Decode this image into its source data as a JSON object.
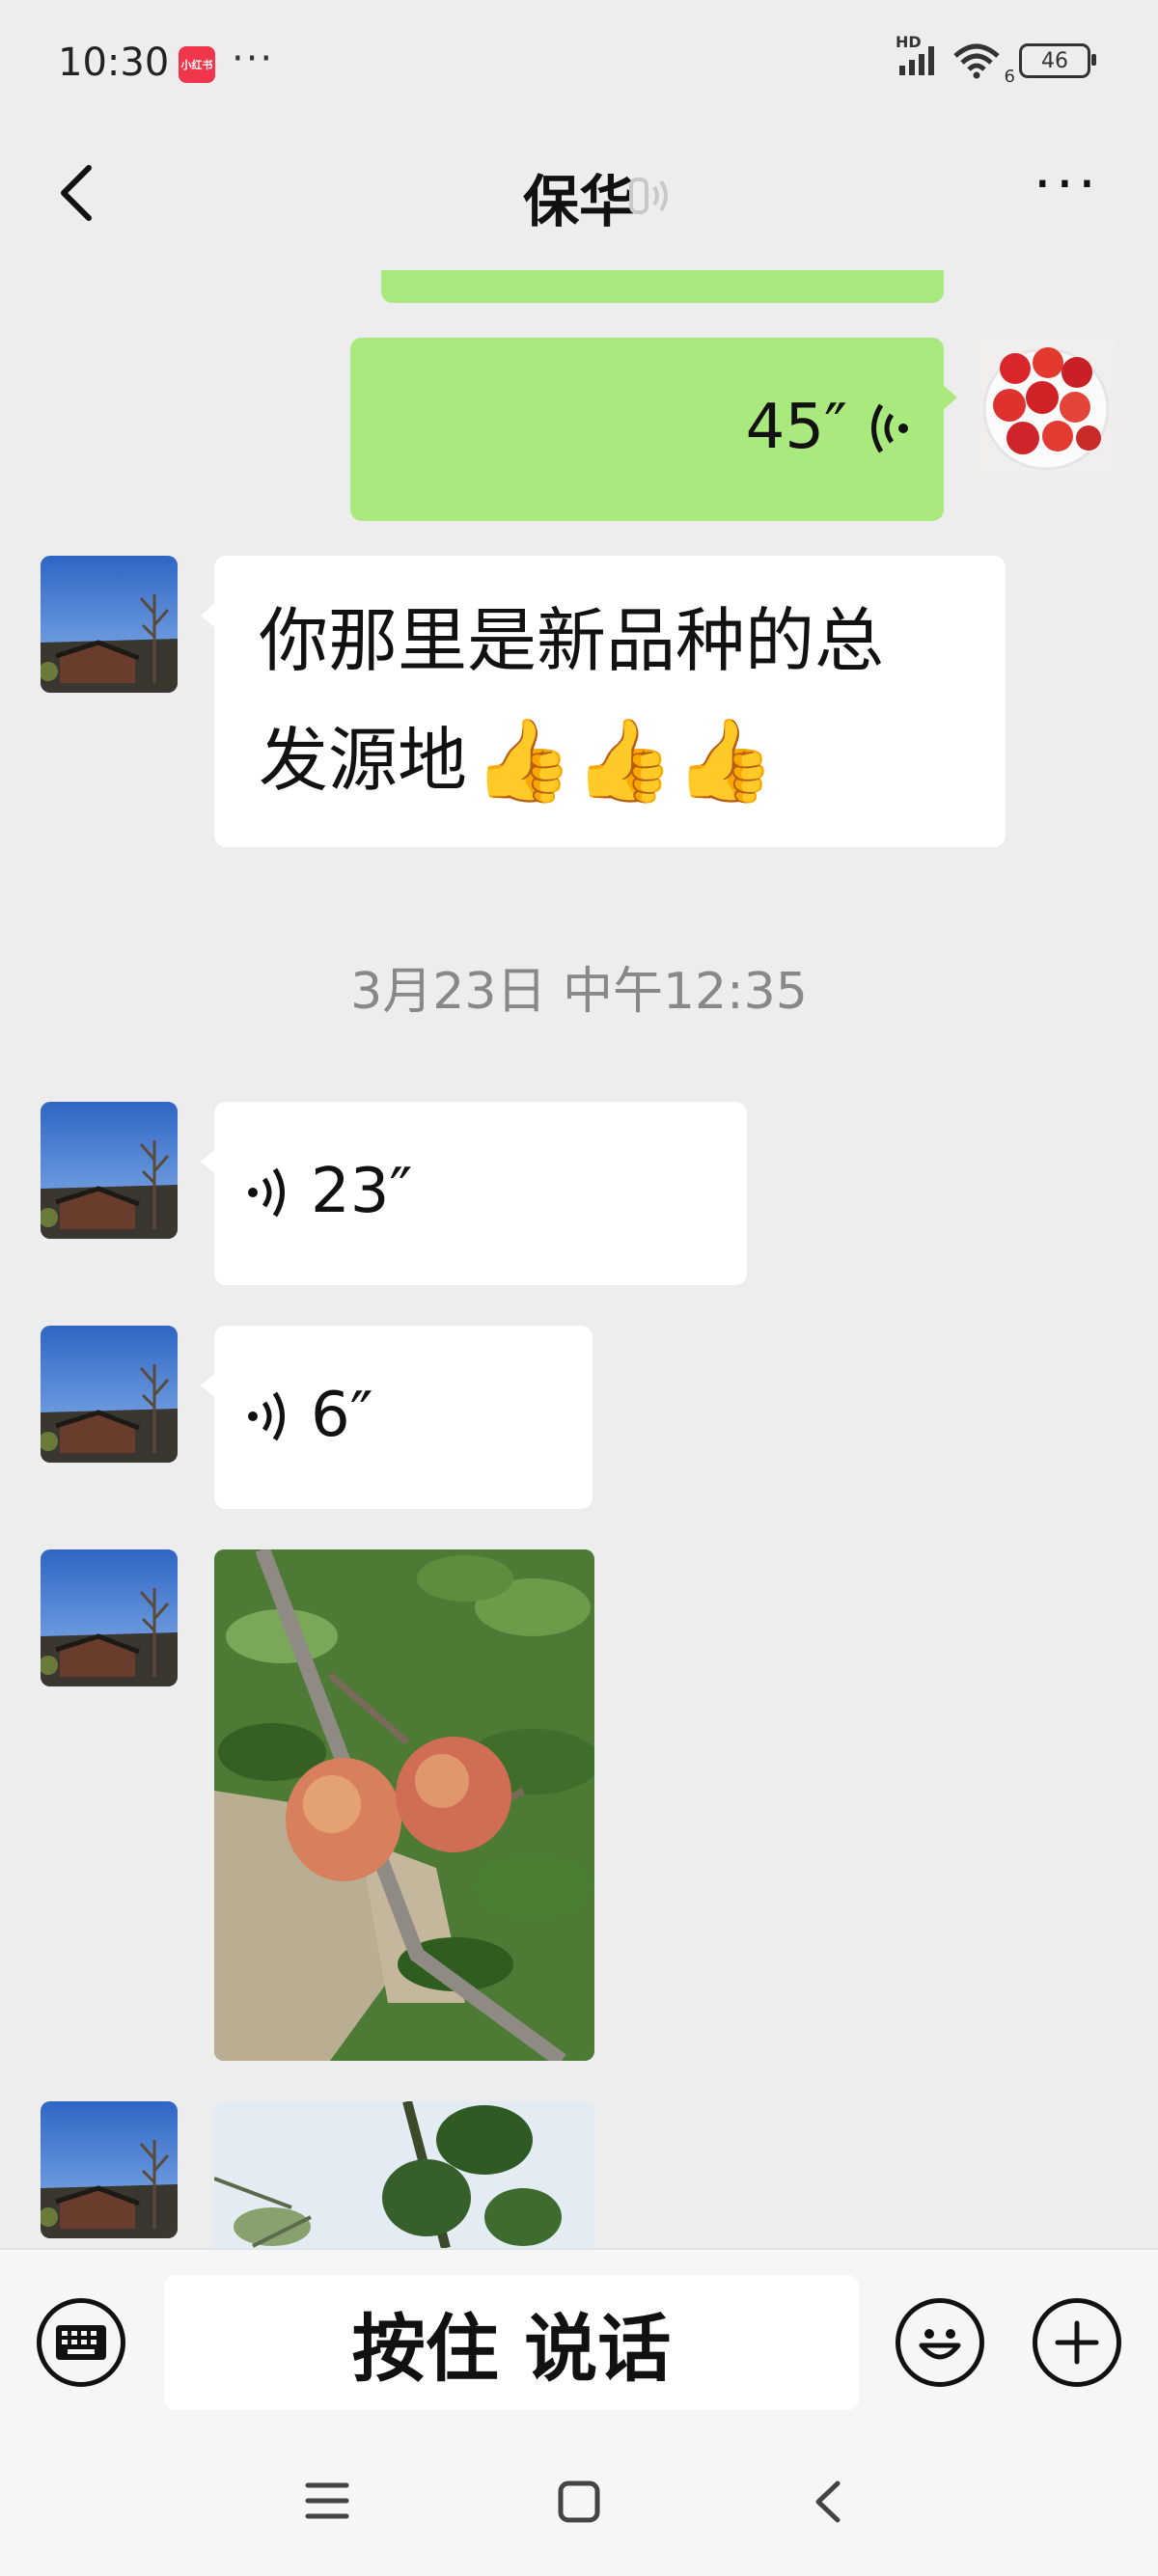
{
  "status_bar": {
    "time": "10:30",
    "app_badge": "小红书",
    "more": "···",
    "network_label": "HD",
    "wifi_sub": "6",
    "battery": "46"
  },
  "header": {
    "title": "保华",
    "more": "···"
  },
  "messages": [
    {
      "side": "right",
      "type": "voice",
      "duration": "45″"
    },
    {
      "side": "left",
      "type": "text",
      "lines": [
        "你那里是新品种的总",
        "发源地"
      ],
      "emoji": [
        "👍",
        "👍",
        "👍"
      ]
    },
    {
      "side": "center",
      "type": "timestamp",
      "text": "3月23日 中午12:35"
    },
    {
      "side": "left",
      "type": "voice",
      "duration": "23″"
    },
    {
      "side": "left",
      "type": "voice",
      "duration": "6″"
    },
    {
      "side": "left",
      "type": "image",
      "description_icon": "pear-photo"
    },
    {
      "side": "left",
      "type": "image",
      "description_icon": "tree-photo"
    }
  ],
  "input": {
    "hold_to_talk": "按住 说话"
  },
  "colors": {
    "sent_bubble": "#a9e97d",
    "received_bubble": "#ffffff",
    "background": "#ededed"
  }
}
